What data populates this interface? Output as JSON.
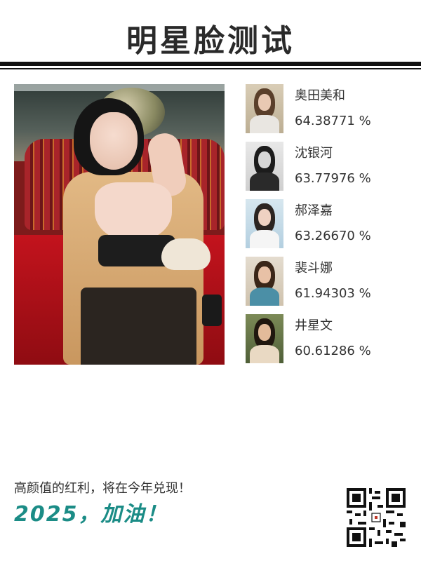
{
  "header": {
    "title": "明星脸测试"
  },
  "results": [
    {
      "name": "奥田美和",
      "percent": "64.38771 %"
    },
    {
      "name": "沈银河",
      "percent": "63.77976 %"
    },
    {
      "name": "郝泽嘉",
      "percent": "63.26670 %"
    },
    {
      "name": "裴斗娜",
      "percent": "61.94303 %"
    },
    {
      "name": "井星文",
      "percent": "60.61286 %"
    }
  ],
  "footer": {
    "slogan": "高颜值的红利，将在今年兑现！",
    "cheer": "2025，加油！"
  },
  "colors": {
    "accent": "#1b8c86",
    "title": "#2a2a2a"
  }
}
